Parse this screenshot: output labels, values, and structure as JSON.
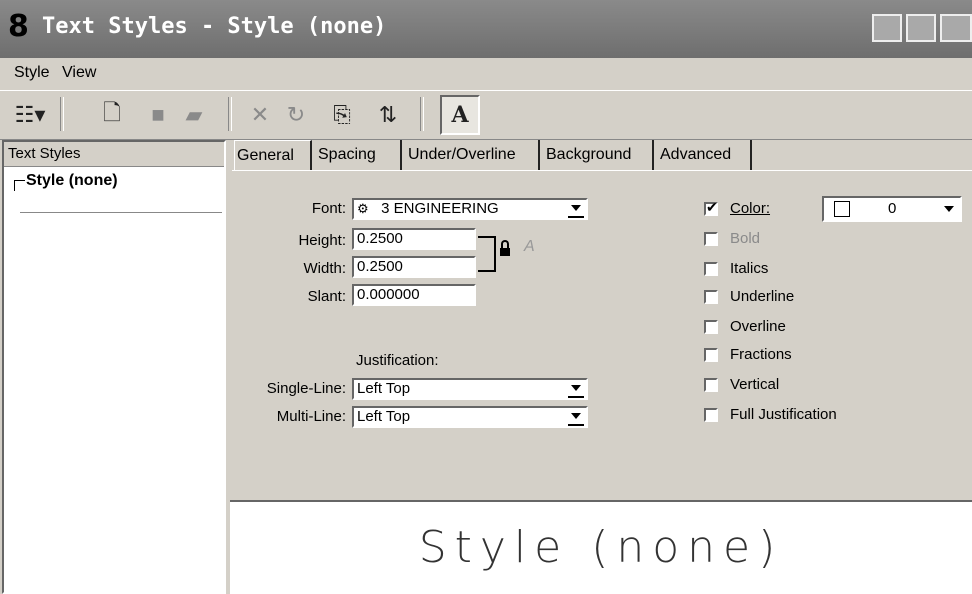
{
  "window": {
    "title": "Text Styles - Style (none)"
  },
  "menu": {
    "items": [
      {
        "label": "Style",
        "key": "S"
      },
      {
        "label": "View",
        "key": "V"
      }
    ]
  },
  "toolbar": {
    "buttons": [
      "tree-view-icon",
      "new-style-icon",
      "save-icon",
      "save-as-icon",
      "delete-icon",
      "reset-icon",
      "copy-icon",
      "import-export-icon",
      "text-preview-icon"
    ]
  },
  "tree": {
    "header": "Text Styles",
    "items": [
      "Style (none)"
    ]
  },
  "tabs": [
    "General",
    "Spacing",
    "Under/Overline",
    "Background",
    "Advanced"
  ],
  "general": {
    "font_label": "Font:",
    "font_value": "3   ENGINEERING",
    "height_label": "Height:",
    "height_value": "0.2500",
    "width_label": "Width:",
    "width_value": "0.2500",
    "slant_label": "Slant:",
    "slant_value": "0.000000",
    "justification_heading": "Justification:",
    "single_line_label": "Single-Line:",
    "single_line_value": "Left Top",
    "multi_line_label": "Multi-Line:",
    "multi_line_value": "Left Top"
  },
  "options": {
    "color_label": "Color:",
    "color_checked": true,
    "color_value": "0",
    "checkboxes": [
      {
        "label": "Bold",
        "checked": false,
        "disabled": true
      },
      {
        "label": "Italics",
        "checked": false,
        "disabled": false
      },
      {
        "label": "Underline",
        "checked": false,
        "disabled": false
      },
      {
        "label": "Overline",
        "checked": false,
        "disabled": false
      },
      {
        "label": "Fractions",
        "checked": false,
        "disabled": false
      },
      {
        "label": "Vertical",
        "checked": false,
        "disabled": false
      },
      {
        "label": "Full Justification",
        "checked": false,
        "disabled": false
      }
    ]
  },
  "preview": {
    "text": "Style (none)"
  }
}
